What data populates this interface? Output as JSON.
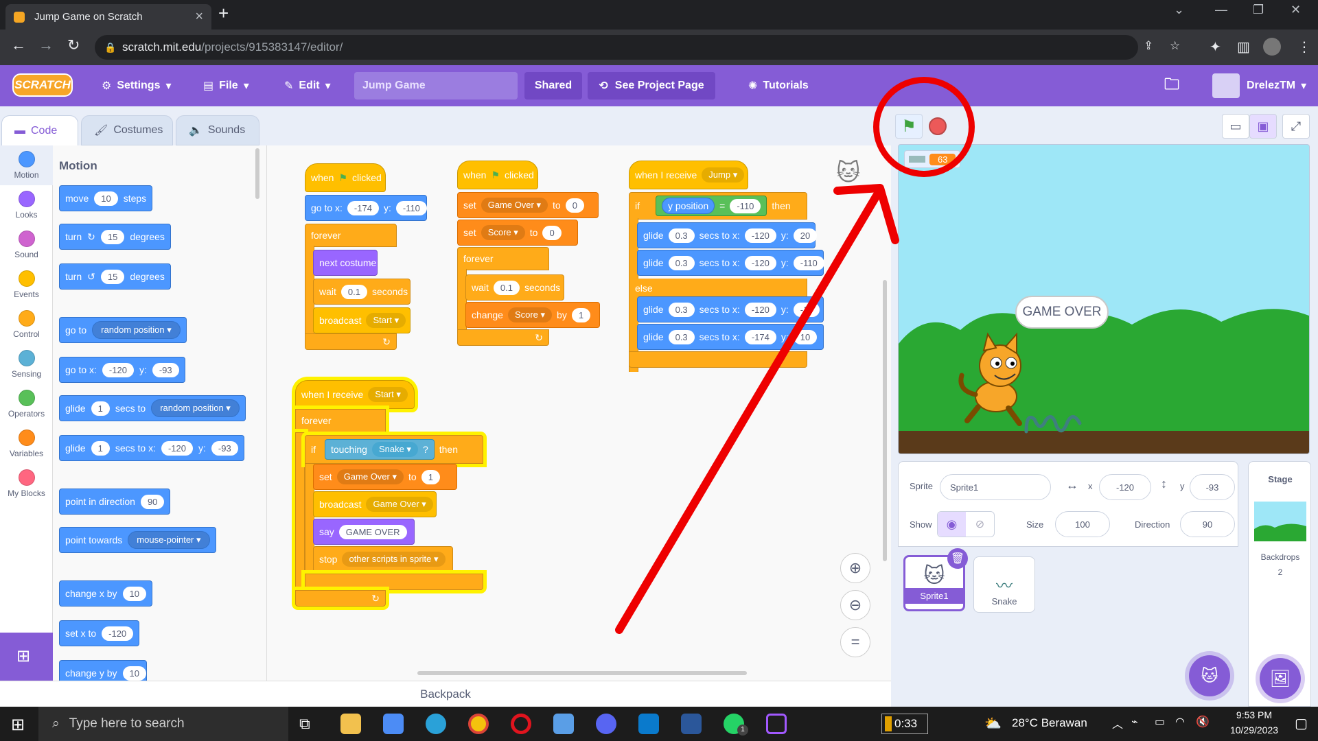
{
  "browser": {
    "tab_title": "Jump Game on Scratch",
    "url_host": "scratch.mit.edu",
    "url_path": "/projects/915383147/editor/"
  },
  "menubar": {
    "logo": "SCRATCH",
    "settings": "Settings",
    "file": "File",
    "edit": "Edit",
    "project_title": "Jump Game",
    "shared": "Shared",
    "see_project_page": "See Project Page",
    "tutorials": "Tutorials",
    "username": "DrelezTM"
  },
  "editor_tabs": [
    "Code",
    "Costumes",
    "Sounds"
  ],
  "categories": [
    {
      "label": "Motion",
      "color": "#4c97ff"
    },
    {
      "label": "Looks",
      "color": "#9966ff"
    },
    {
      "label": "Sound",
      "color": "#cf63cf"
    },
    {
      "label": "Events",
      "color": "#ffbf00"
    },
    {
      "label": "Control",
      "color": "#ffab19"
    },
    {
      "label": "Sensing",
      "color": "#5cb1d6"
    },
    {
      "label": "Operators",
      "color": "#59c059"
    },
    {
      "label": "Variables",
      "color": "#ff8c1a"
    },
    {
      "label": "My Blocks",
      "color": "#ff6680"
    }
  ],
  "palette": {
    "heading": "Motion",
    "move": {
      "a": "move",
      "v": "10",
      "b": "steps"
    },
    "turn_cw": {
      "a": "turn",
      "v": "15",
      "b": "degrees"
    },
    "turn_ccw": {
      "a": "turn",
      "v": "15",
      "b": "degrees"
    },
    "goto": {
      "a": "go to",
      "dd": "random position"
    },
    "goto_xy": {
      "a": "go to x:",
      "x": "-120",
      "b": "y:",
      "y": "-93"
    },
    "glide_rand": {
      "a": "glide",
      "v": "1",
      "b": "secs to",
      "dd": "random position"
    },
    "glide_xy": {
      "a": "glide",
      "v": "1",
      "b": "secs to x:",
      "x": "-120",
      "c": "y:",
      "y": "-93"
    },
    "point_dir": {
      "a": "point in direction",
      "v": "90"
    },
    "point_towards": {
      "a": "point towards",
      "dd": "mouse-pointer"
    },
    "change_x": {
      "a": "change x by",
      "v": "10"
    },
    "set_x": {
      "a": "set x to",
      "v": "-120"
    },
    "change_y": {
      "a": "change y by",
      "v": "10"
    }
  },
  "script1": {
    "when": "when",
    "clicked": "clicked",
    "goto": "go to x:",
    "x": "-174",
    "ylbl": "y:",
    "y": "-110",
    "forever": "forever",
    "next_costume": "next costume",
    "wait": "wait",
    "wait_v": "0.1",
    "seconds": "seconds",
    "broadcast": "broadcast",
    "broadcast_dd": "Start"
  },
  "script2": {
    "when": "when",
    "clicked": "clicked",
    "set": "set",
    "var1": "Game Over",
    "to": "to",
    "val1": "0",
    "var2": "Score",
    "val2": "0",
    "forever": "forever",
    "wait": "wait",
    "wait_v": "0.1",
    "seconds": "seconds",
    "change": "change",
    "change_var": "Score",
    "by": "by",
    "change_v": "1"
  },
  "script3": {
    "receive": "when I receive",
    "msg": "Jump",
    "if": "if",
    "ypos": "y position",
    "eq": "=",
    "cmp": "-110",
    "then": "then",
    "glide": "glide",
    "secs": "0.3",
    "secs_to": "secs to x:",
    "ylbl": "y:",
    "g1x": "-120",
    "g1y": "20",
    "g2x": "-120",
    "g2y": "-110",
    "else": "else",
    "g3x": "-120",
    "g3y": "-11",
    "g4x": "-174",
    "g4y": "10"
  },
  "script4": {
    "receive": "when I receive",
    "msg": "Start",
    "forever": "forever",
    "if": "if",
    "touching": "touching",
    "target": "Snake",
    "q": "?",
    "then": "then",
    "set": "set",
    "var": "Game Over",
    "to": "to",
    "val": "1",
    "broadcast": "broadcast",
    "bmsg": "Game Over",
    "say": "say",
    "say_text": "GAME OVER",
    "stop": "stop",
    "stop_dd": "other scripts in sprite"
  },
  "backpack": "Backpack",
  "stage": {
    "score_value": "63",
    "speech": "GAME OVER"
  },
  "sprite_info": {
    "sprite_lbl": "Sprite",
    "sprite_name": "Sprite1",
    "x_lbl": "x",
    "x": "-120",
    "y_lbl": "y",
    "y": "-93",
    "show_lbl": "Show",
    "size_lbl": "Size",
    "size": "100",
    "dir_lbl": "Direction",
    "dir": "90"
  },
  "sprites": [
    "Sprite1",
    "Snake"
  ],
  "stage_panel": {
    "title": "Stage",
    "backdrops_lbl": "Backdrops",
    "backdrops": "2"
  },
  "taskbar": {
    "search_placeholder": "Type here to search",
    "battery": "0:33",
    "weather": "28°C  Berawan",
    "time": "9:53 PM",
    "date": "10/29/2023",
    "badge": "1"
  },
  "colors": {
    "annotation": "#ee0000",
    "scratch_purple": "#855cd6"
  }
}
